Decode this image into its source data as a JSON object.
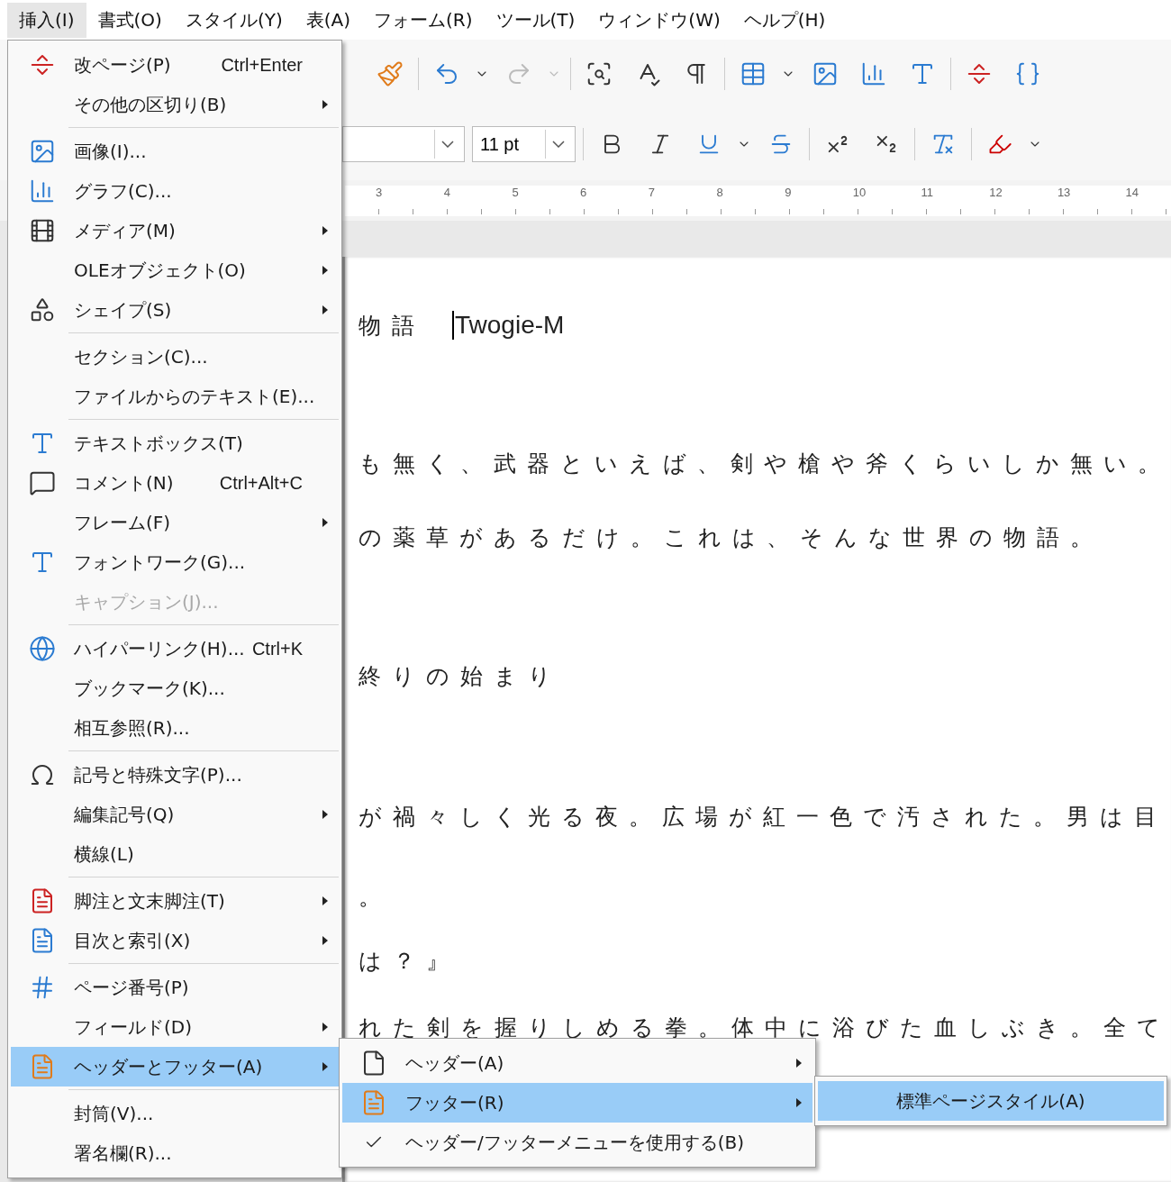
{
  "menubar": [
    {
      "label": "挿入(I)",
      "selected": true
    },
    {
      "label": "書式(O)",
      "selected": false
    },
    {
      "label": "スタイル(Y)",
      "selected": false
    },
    {
      "label": "表(A)",
      "selected": false
    },
    {
      "label": "フォーム(R)",
      "selected": false
    },
    {
      "label": "ツール(T)",
      "selected": false
    },
    {
      "label": "ウィンドウ(W)",
      "selected": false
    },
    {
      "label": "ヘルプ(H)",
      "selected": false
    }
  ],
  "toolbar": {
    "font_size": "11 pt"
  },
  "ruler": {
    "labels": [
      "3",
      "4",
      "5",
      "6",
      "7",
      "8",
      "9",
      "10",
      "11",
      "12",
      "13",
      "14"
    ]
  },
  "document": {
    "title": "物語",
    "author": "Twogie-M",
    "lines": [
      "も無く、武器といえば、剣や槍や斧くらいしか無い。",
      "の薬草があるだけ。これは、そんな世界の物語。",
      "終りの始まり",
      "が禍々しく光る夜。広場が紅一色で汚された。男は目",
      "。",
      "は？』",
      "れた剣を握りしめる拳。体中に浴びた血しぶき。全て"
    ]
  },
  "insert_menu": {
    "items": [
      {
        "kind": "item",
        "label": "改ページ(P)",
        "shortcut": "Ctrl+Enter",
        "submenu": false,
        "disabled": false,
        "selected": false
      },
      {
        "kind": "item",
        "label": "その他の区切り(B)",
        "submenu": true,
        "disabled": false,
        "selected": false
      },
      {
        "kind": "separator"
      },
      {
        "kind": "item",
        "label": "画像(I)...",
        "submenu": false,
        "disabled": false,
        "selected": false
      },
      {
        "kind": "item",
        "label": "グラフ(C)...",
        "submenu": false,
        "disabled": false,
        "selected": false
      },
      {
        "kind": "item",
        "label": "メディア(M)",
        "submenu": true,
        "disabled": false,
        "selected": false
      },
      {
        "kind": "item",
        "label": "OLEオブジェクト(O)",
        "submenu": true,
        "disabled": false,
        "selected": false
      },
      {
        "kind": "item",
        "label": "シェイプ(S)",
        "submenu": true,
        "disabled": false,
        "selected": false
      },
      {
        "kind": "separator"
      },
      {
        "kind": "item",
        "label": "セクション(C)...",
        "submenu": false,
        "disabled": false,
        "selected": false
      },
      {
        "kind": "item",
        "label": "ファイルからのテキスト(E)...",
        "submenu": false,
        "disabled": false,
        "selected": false
      },
      {
        "kind": "separator"
      },
      {
        "kind": "item",
        "label": "テキストボックス(T)",
        "submenu": false,
        "disabled": false,
        "selected": false
      },
      {
        "kind": "item",
        "label": "コメント(N)",
        "shortcut": "Ctrl+Alt+C",
        "submenu": false,
        "disabled": false,
        "selected": false
      },
      {
        "kind": "item",
        "label": "フレーム(F)",
        "submenu": true,
        "disabled": false,
        "selected": false
      },
      {
        "kind": "item",
        "label": "フォントワーク(G)...",
        "submenu": false,
        "disabled": false,
        "selected": false
      },
      {
        "kind": "item",
        "label": "キャプション(J)...",
        "submenu": false,
        "disabled": true,
        "selected": false
      },
      {
        "kind": "separator"
      },
      {
        "kind": "item",
        "label": "ハイパーリンク(H)...",
        "shortcut": "Ctrl+K",
        "submenu": false,
        "disabled": false,
        "selected": false
      },
      {
        "kind": "item",
        "label": "ブックマーク(K)...",
        "submenu": false,
        "disabled": false,
        "selected": false
      },
      {
        "kind": "item",
        "label": "相互参照(R)...",
        "submenu": false,
        "disabled": false,
        "selected": false
      },
      {
        "kind": "separator"
      },
      {
        "kind": "item",
        "label": "記号と特殊文字(P)...",
        "submenu": false,
        "disabled": false,
        "selected": false
      },
      {
        "kind": "item",
        "label": "編集記号(Q)",
        "submenu": true,
        "disabled": false,
        "selected": false
      },
      {
        "kind": "item",
        "label": "横線(L)",
        "submenu": false,
        "disabled": false,
        "selected": false
      },
      {
        "kind": "separator"
      },
      {
        "kind": "item",
        "label": "脚注と文末脚注(T)",
        "submenu": true,
        "disabled": false,
        "selected": false
      },
      {
        "kind": "item",
        "label": "目次と索引(X)",
        "submenu": true,
        "disabled": false,
        "selected": false
      },
      {
        "kind": "separator"
      },
      {
        "kind": "item",
        "label": "ページ番号(P)",
        "submenu": false,
        "disabled": false,
        "selected": false
      },
      {
        "kind": "item",
        "label": "フィールド(D)",
        "submenu": true,
        "disabled": false,
        "selected": false
      },
      {
        "kind": "item",
        "label": "ヘッダーとフッター(A)",
        "submenu": true,
        "disabled": false,
        "selected": true
      },
      {
        "kind": "separator"
      },
      {
        "kind": "item",
        "label": "封筒(V)...",
        "submenu": false,
        "disabled": false,
        "selected": false
      },
      {
        "kind": "item",
        "label": "署名欄(R)...",
        "submenu": false,
        "disabled": false,
        "selected": false
      }
    ]
  },
  "header_footer_menu": {
    "items": [
      {
        "label": "ヘッダー(A)",
        "submenu": true,
        "checked": false,
        "selected": false
      },
      {
        "label": "フッター(R)",
        "submenu": true,
        "checked": false,
        "selected": true
      },
      {
        "label": "ヘッダー/フッターメニューを使用する(B)",
        "submenu": false,
        "checked": true,
        "selected": false
      }
    ]
  },
  "footer_menu": {
    "items": [
      {
        "label": "標準ページスタイル(A)",
        "selected": true
      }
    ]
  }
}
